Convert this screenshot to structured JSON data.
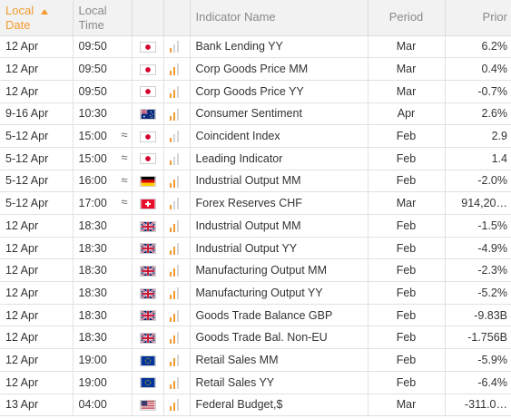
{
  "colors": {
    "accent": "#f29a2e",
    "inactive_bar": "#d6d6d6"
  },
  "header": {
    "date_line1": "Local",
    "date_line2": "Date",
    "time_line1": "Local",
    "time_line2": "Time",
    "indicator": "Indicator Name",
    "period": "Period",
    "prior": "Prior"
  },
  "rows": [
    {
      "date": "12 Apr",
      "time": "09:50",
      "approx": "",
      "flag": "jp-flag-icon",
      "volatility": 1,
      "name": "Bank Lending YY",
      "period": "Mar",
      "prior": "6.2%"
    },
    {
      "date": "12 Apr",
      "time": "09:50",
      "approx": "",
      "flag": "jp-flag-icon",
      "volatility": 2,
      "name": "Corp Goods Price MM",
      "period": "Mar",
      "prior": "0.4%"
    },
    {
      "date": "12 Apr",
      "time": "09:50",
      "approx": "",
      "flag": "jp-flag-icon",
      "volatility": 2,
      "name": "Corp Goods Price YY",
      "period": "Mar",
      "prior": "-0.7%"
    },
    {
      "date": "9-16 Apr",
      "time": "10:30",
      "approx": "",
      "flag": "au-flag-icon",
      "volatility": 2,
      "name": "Consumer Sentiment",
      "period": "Apr",
      "prior": "2.6%"
    },
    {
      "date": "5-12 Apr",
      "time": "15:00",
      "approx": "≈",
      "flag": "jp-flag-icon",
      "volatility": 1,
      "name": "Coincident Index",
      "period": "Feb",
      "prior": "2.9"
    },
    {
      "date": "5-12 Apr",
      "time": "15:00",
      "approx": "≈",
      "flag": "jp-flag-icon",
      "volatility": 1,
      "name": "Leading Indicator",
      "period": "Feb",
      "prior": "1.4"
    },
    {
      "date": "5-12 Apr",
      "time": "16:00",
      "approx": "≈",
      "flag": "de-flag-icon",
      "volatility": 2,
      "name": "Industrial Output MM",
      "period": "Feb",
      "prior": "-2.0%"
    },
    {
      "date": "5-12 Apr",
      "time": "17:00",
      "approx": "≈",
      "flag": "ch-flag-icon",
      "volatility": 1,
      "name": "Forex Reserves CHF",
      "period": "Mar",
      "prior": "914,20…"
    },
    {
      "date": "12 Apr",
      "time": "18:30",
      "approx": "",
      "flag": "gb-flag-icon",
      "volatility": 2,
      "name": "Industrial Output MM",
      "period": "Feb",
      "prior": "-1.5%"
    },
    {
      "date": "12 Apr",
      "time": "18:30",
      "approx": "",
      "flag": "gb-flag-icon",
      "volatility": 2,
      "name": "Industrial Output YY",
      "period": "Feb",
      "prior": "-4.9%"
    },
    {
      "date": "12 Apr",
      "time": "18:30",
      "approx": "",
      "flag": "gb-flag-icon",
      "volatility": 2,
      "name": "Manufacturing Output MM",
      "period": "Feb",
      "prior": "-2.3%"
    },
    {
      "date": "12 Apr",
      "time": "18:30",
      "approx": "",
      "flag": "gb-flag-icon",
      "volatility": 2,
      "name": "Manufacturing Output YY",
      "period": "Feb",
      "prior": "-5.2%"
    },
    {
      "date": "12 Apr",
      "time": "18:30",
      "approx": "",
      "flag": "gb-flag-icon",
      "volatility": 2,
      "name": "Goods Trade Balance GBP",
      "period": "Feb",
      "prior": "-9.83B"
    },
    {
      "date": "12 Apr",
      "time": "18:30",
      "approx": "",
      "flag": "gb-flag-icon",
      "volatility": 2,
      "name": "Goods Trade Bal. Non-EU",
      "period": "Feb",
      "prior": "-1.756B"
    },
    {
      "date": "12 Apr",
      "time": "19:00",
      "approx": "",
      "flag": "eu-flag-icon",
      "volatility": 2,
      "name": "Retail Sales MM",
      "period": "Feb",
      "prior": "-5.9%"
    },
    {
      "date": "12 Apr",
      "time": "19:00",
      "approx": "",
      "flag": "eu-flag-icon",
      "volatility": 2,
      "name": "Retail Sales YY",
      "period": "Feb",
      "prior": "-6.4%"
    },
    {
      "date": "13 Apr",
      "time": "04:00",
      "approx": "",
      "flag": "us-flag-icon",
      "volatility": 2,
      "name": "Federal Budget,$",
      "period": "Mar",
      "prior": "-311.0…"
    }
  ]
}
